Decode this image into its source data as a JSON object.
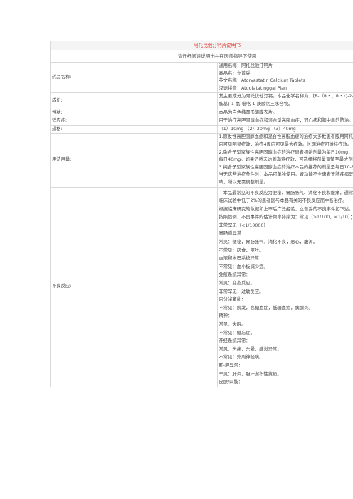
{
  "title": "阿托伐他汀钙片说明书",
  "subtitle": "请仔细阅读说明书并在医师指导下使用",
  "rows": {
    "names": {
      "key": "药品名称:",
      "lines": [
        "通用名称：阿托伐他汀钙片",
        "商品名：立普妥",
        "英文名称：Atorvastatin Calcium Tablets",
        "汉语拼音：Atuofatatinggai Pian"
      ]
    },
    "ingredients": {
      "key": "成份:",
      "lines": [
        "其主要成分为阿托伐他汀钙。本品化学名称为：[R-（R﹡，R﹡）]-2-（4-氟苯基）—二羟基-5-(1-甲基乙基)-3-苯基-4-[(苯",
        "胺基]-1-氢-吡咯-1-庚酸钙三水合物。"
      ]
    },
    "appearance": {
      "key": "性状:",
      "lines": [
        "本品为白色椭圆形薄膜衣片。"
      ]
    },
    "indications": {
      "key": "适应症:",
      "lines": [
        "用于治疗高胆固醇血症和混合型高脂血症；冠心病和脑中风的防治。"
      ]
    },
    "specs": {
      "key": "规格:",
      "lines": [
        "（1）10mg （2）20mg （3）40mg"
      ]
    },
    "dosage": {
      "key": "用法用量:",
      "lines": [
        "1.原发性高胆固醇血症和混合性高脂血症的治疗大多数患者服用阿托伐他汀每日一次10mg，其血脂水平可得到控制。治疗",
        "内可见明显疗效，治疗4周内可见最大疗效。长期治疗可维持疗效。",
        "2.杂合子型家族性高胆固醇血症的治疗患者初始剂量为每日10mg，应遵循剂量的个体化原则并每4周为时间间隔逐步调",
        "每日40mg。如果仍然未达到满意疗效，可选择将剂量调整至最大剂量每日80mg，或以每日40mg本品配合服合用治疗。",
        "3.纯合子型家族性高胆固醇血症的治疗本品的推荐的剂量是每日10-80mg。阿托伐他汀钙应作为其它降脂治疗措施的辅",
        "当无这些治疗条件时，本品可单独使用。肾功能不全患者肾脏疾病既不会对本品的血浆浓度产生影响，也不会对其降脂效",
        "响，所以无需调整剂量。"
      ]
    },
    "adverse": {
      "key": "不良反应:",
      "lines": [
        "本品最常见的不良反应为便秘、胃肠胀气、消化不良和腹痛，通常在继续用药后缓解。",
        "临床试验中低于2%的患者因与本品有关的不良反应而中断治疗。",
        "根据临床研究的数据和上市后广泛经验，立普妥的不良事件如下述。",
        "按照惯例，不良事件的估计频率排序为：常见（>1/100，<1/10）；不常见（>1/1000，<1/100）；罕见（>1/10000，<1/1",
        "非常罕见（<1/10000）",
        "胃肠道异常",
        "常见：便秘，胃肠胀气，消化不良，恶心，腹泻。",
        "不常见：厌食，呕吐。",
        "血液和淋巴系统异常",
        "不常见：血小板减少症。",
        "免疫系统异常：",
        "常见：变态反应。",
        "非常罕见：过敏反应。",
        "内分泌紊乱：",
        "不常见：脱发，高糖血症，低糖血症，胰腺炎。",
        "精神：",
        "常见：失眠。",
        "不常见：健忘症。",
        "神经系统异常：",
        "常见：头痛，头晕，感觉异常。",
        "不常见：外周神经病。",
        "肝-胆异常：",
        "罕见：肝炎，胆汁淤积性黄疸。",
        "皮肤/四肢："
      ]
    }
  }
}
